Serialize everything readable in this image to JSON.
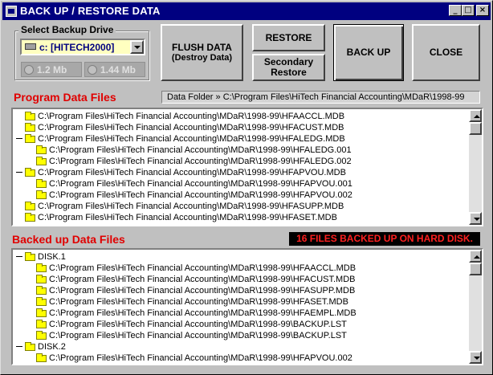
{
  "window": {
    "title": "BACK UP / RESTORE DATA"
  },
  "titlebar_buttons": {
    "minimize": "_",
    "maximize": "□",
    "close": "×"
  },
  "backup_drive": {
    "group_label": "Select Backup Drive",
    "selected_drive": "c: [HITECH2000]",
    "options": [
      "1.2 Mb",
      "1.44 Mb"
    ]
  },
  "buttons": {
    "flush_line1": "FLUSH DATA",
    "flush_line2": "(Destroy Data)",
    "restore": "RESTORE",
    "secondary_line1": "Secondary",
    "secondary_line2": "Restore",
    "back_up": "BACK UP",
    "close": "CLOSE"
  },
  "program_files": {
    "title": "Program Data Files",
    "data_folder": "Data Folder » C:\\Program Files\\HiTech Financial Accounting\\MDaR\\1998-99",
    "items": [
      {
        "expanded": false,
        "level": 0,
        "text": "C:\\Program Files\\HiTech Financial Accounting\\MDaR\\1998-99\\HFAACCL.MDB"
      },
      {
        "expanded": false,
        "level": 0,
        "text": "C:\\Program Files\\HiTech Financial Accounting\\MDaR\\1998-99\\HFACUST.MDB"
      },
      {
        "expanded": true,
        "level": 0,
        "text": "C:\\Program Files\\HiTech Financial Accounting\\MDaR\\1998-99\\HFALEDG.MDB"
      },
      {
        "expanded": false,
        "level": 1,
        "text": "C:\\Program Files\\HiTech Financial Accounting\\MDaR\\1998-99\\HFALEDG.001"
      },
      {
        "expanded": false,
        "level": 1,
        "text": "C:\\Program Files\\HiTech Financial Accounting\\MDaR\\1998-99\\HFALEDG.002"
      },
      {
        "expanded": true,
        "level": 0,
        "text": "C:\\Program Files\\HiTech Financial Accounting\\MDaR\\1998-99\\HFAPVOU.MDB"
      },
      {
        "expanded": false,
        "level": 1,
        "text": "C:\\Program Files\\HiTech Financial Accounting\\MDaR\\1998-99\\HFAPVOU.001"
      },
      {
        "expanded": false,
        "level": 1,
        "text": "C:\\Program Files\\HiTech Financial Accounting\\MDaR\\1998-99\\HFAPVOU.002"
      },
      {
        "expanded": false,
        "level": 0,
        "text": "C:\\Program Files\\HiTech Financial Accounting\\MDaR\\1998-99\\HFASUPP.MDB"
      },
      {
        "expanded": false,
        "level": 0,
        "text": "C:\\Program Files\\HiTech Financial Accounting\\MDaR\\1998-99\\HFASET.MDB"
      }
    ]
  },
  "backed_up_files": {
    "title": "Backed up Data Files",
    "status": "16 FILES BACKED UP ON HARD DISK.",
    "items": [
      {
        "expanded": true,
        "level": 0,
        "text": "DISK.1"
      },
      {
        "expanded": false,
        "level": 1,
        "text": "C:\\Program Files\\HiTech Financial Accounting\\MDaR\\1998-99\\HFAACCL.MDB"
      },
      {
        "expanded": false,
        "level": 1,
        "text": "C:\\Program Files\\HiTech Financial Accounting\\MDaR\\1998-99\\HFACUST.MDB"
      },
      {
        "expanded": false,
        "level": 1,
        "text": "C:\\Program Files\\HiTech Financial Accounting\\MDaR\\1998-99\\HFASUPP.MDB"
      },
      {
        "expanded": false,
        "level": 1,
        "text": "C:\\Program Files\\HiTech Financial Accounting\\MDaR\\1998-99\\HFASET.MDB"
      },
      {
        "expanded": false,
        "level": 1,
        "text": "C:\\Program Files\\HiTech Financial Accounting\\MDaR\\1998-99\\HFAEMPL.MDB"
      },
      {
        "expanded": false,
        "level": 1,
        "text": "C:\\Program Files\\HiTech Financial Accounting\\MDaR\\1998-99\\BACKUP.LST"
      },
      {
        "expanded": false,
        "level": 1,
        "text": "C:\\Program Files\\HiTech Financial Accounting\\MDaR\\1998-99\\BACKUP.LST"
      },
      {
        "expanded": true,
        "level": 0,
        "text": "DISK.2"
      },
      {
        "expanded": false,
        "level": 1,
        "text": "C:\\Program Files\\HiTech Financial Accounting\\MDaR\\1998-99\\HFAPVOU.002"
      }
    ]
  },
  "colors": {
    "titlebar": "#000080",
    "section_title": "#e00000",
    "status_text": "#ff2020",
    "status_bg": "#000000",
    "drive_field": "#ffffc0",
    "folder": "#ffff00"
  }
}
